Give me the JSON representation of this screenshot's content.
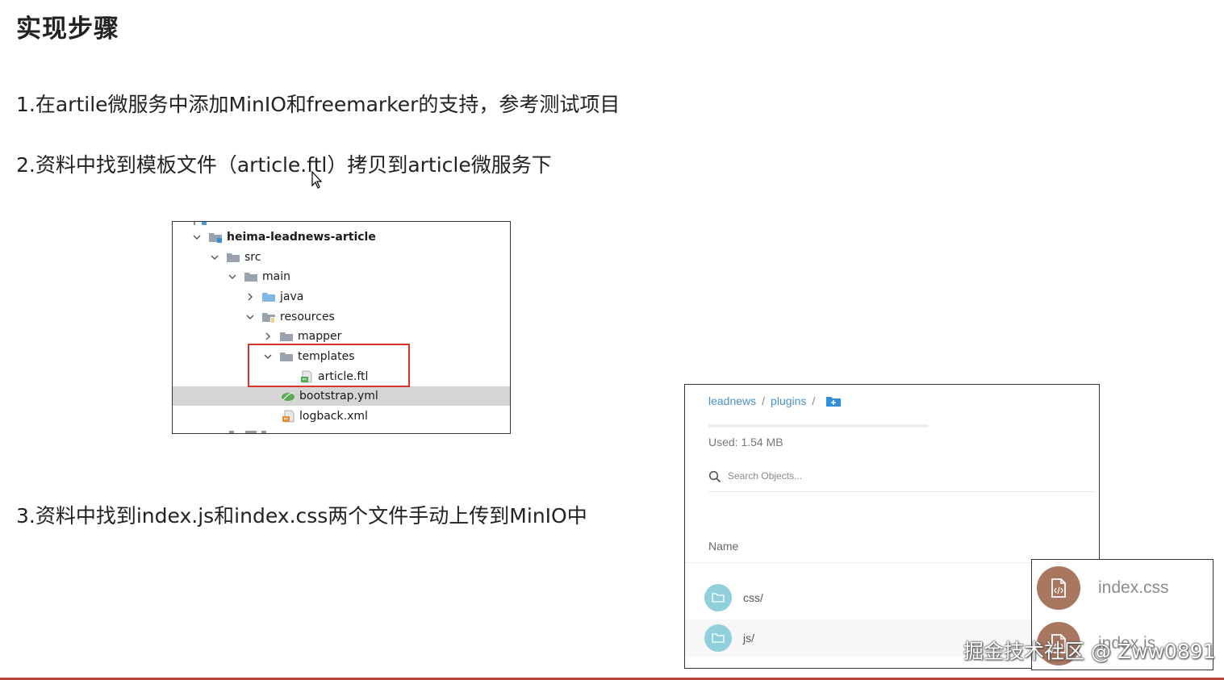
{
  "slide": {
    "title": "实现步骤",
    "step1": "1.在artile微服务中添加MinIO和freemarker的支持，参考测试项目",
    "step2": "2.资料中找到模板文件（article.ftl）拷贝到article微服务下",
    "step3": "3.资料中找到index.js和index.css两个文件手动上传到MinIO中"
  },
  "project_tree": {
    "items": [
      {
        "label": "heima-leadnews-article",
        "icon": "module-folder-icon",
        "expanded": true
      },
      {
        "label": "src",
        "icon": "folder-icon",
        "expanded": true
      },
      {
        "label": "main",
        "icon": "folder-icon",
        "expanded": true
      },
      {
        "label": "java",
        "icon": "source-folder-icon",
        "expanded": false
      },
      {
        "label": "resources",
        "icon": "resources-folder-icon",
        "expanded": true
      },
      {
        "label": "mapper",
        "icon": "folder-icon",
        "expanded": false
      },
      {
        "label": "templates",
        "icon": "folder-icon",
        "expanded": true
      },
      {
        "label": "article.ftl",
        "icon": "ftl-file-icon"
      },
      {
        "label": "bootstrap.yml",
        "icon": "yml-file-icon",
        "selected": true
      },
      {
        "label": "logback.xml",
        "icon": "xml-file-icon"
      }
    ],
    "highlight_color": "#d9342b"
  },
  "minio": {
    "breadcrumb": [
      "leadnews",
      "plugins"
    ],
    "separator": "/",
    "usage": "Used: 1.54 MB",
    "search_placeholder": "Search Objects...",
    "column_name": "Name",
    "objects": [
      "css/",
      "js/"
    ],
    "accent": "#4a90c8",
    "folder_color": "#8fd0dc"
  },
  "upload_popup": {
    "items": [
      "index.css",
      "index.js"
    ],
    "icon_color": "#a9765f"
  },
  "watermark": "掘金技术社区 @ Zww0891"
}
